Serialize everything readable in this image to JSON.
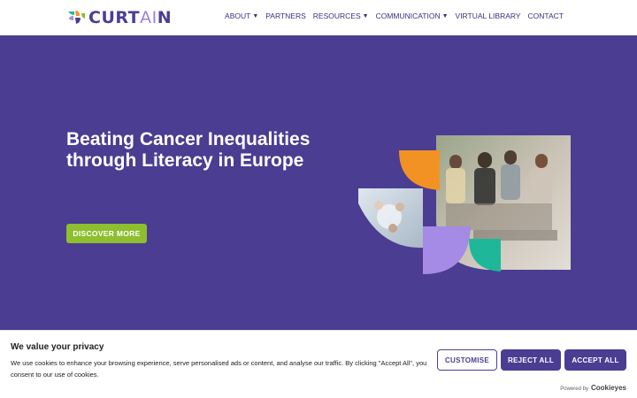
{
  "brand": {
    "logo_text": "CURT",
    "logo_ai": "AI",
    "logo_end": "N"
  },
  "nav": [
    {
      "label": "ABOUT",
      "has_dropdown": true
    },
    {
      "label": "PARTNERS",
      "has_dropdown": false
    },
    {
      "label": "RESOURCES",
      "has_dropdown": true
    },
    {
      "label": "COMMUNICATION",
      "has_dropdown": true
    },
    {
      "label": "VIRTUAL LIBRARY",
      "has_dropdown": false
    },
    {
      "label": "CONTACT",
      "has_dropdown": false
    }
  ],
  "hero": {
    "title": "Beating Cancer Inequalities through Literacy in Europe",
    "button": "DISCOVER MORE"
  },
  "cookie": {
    "title": "We value your privacy",
    "text": "We use cookies to enhance your browsing experience, serve personalised ads or content, and analyse our traffic. By clicking \"Accept All\", you consent to our use of cookies.",
    "customise": "CUSTOMISE",
    "reject": "REJECT ALL",
    "accept": "ACCEPT ALL",
    "powered_by": "Powered by",
    "powered_brand": "Cookieyes"
  },
  "colors": {
    "primary": "#4b3d92",
    "accent_green": "#8dbf2e",
    "orange": "#f39224",
    "lavender": "#a58ae6",
    "teal": "#1fb79a"
  }
}
